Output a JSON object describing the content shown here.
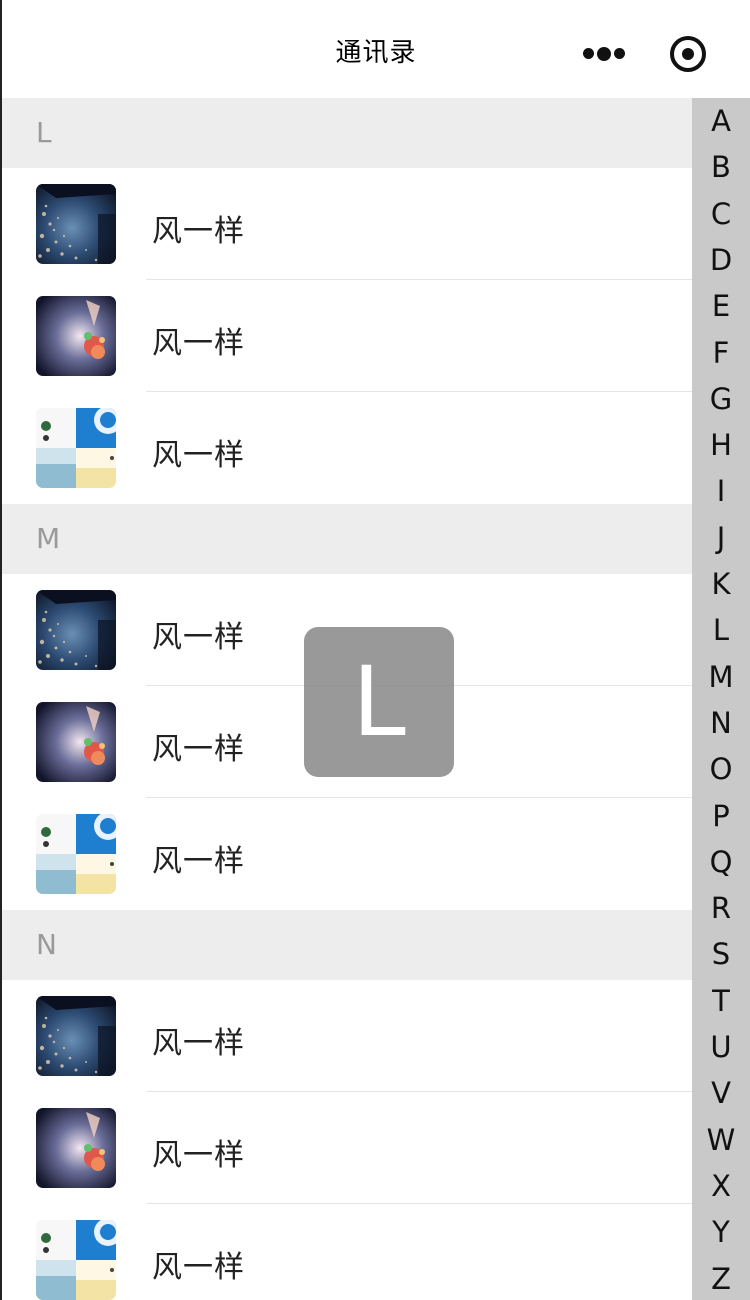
{
  "navbar": {
    "title": "通讯录",
    "menu_icon": "more-dots-icon",
    "close_icon": "close-circle-icon"
  },
  "sections": [
    {
      "letter": "L",
      "contacts": [
        {
          "name": "风一样",
          "avatar": "night-scene"
        },
        {
          "name": "风一样",
          "avatar": "flower"
        },
        {
          "name": "风一样",
          "avatar": "collage"
        }
      ]
    },
    {
      "letter": "M",
      "contacts": [
        {
          "name": "风一样",
          "avatar": "night-scene"
        },
        {
          "name": "风一样",
          "avatar": "flower"
        },
        {
          "name": "风一样",
          "avatar": "collage"
        }
      ]
    },
    {
      "letter": "N",
      "contacts": [
        {
          "name": "风一样",
          "avatar": "night-scene"
        },
        {
          "name": "风一样",
          "avatar": "flower"
        },
        {
          "name": "风一样",
          "avatar": "collage"
        }
      ]
    }
  ],
  "index_letters": [
    "A",
    "B",
    "C",
    "D",
    "E",
    "F",
    "G",
    "H",
    "I",
    "J",
    "K",
    "L",
    "M",
    "N",
    "O",
    "P",
    "Q",
    "R",
    "S",
    "T",
    "U",
    "V",
    "W",
    "X",
    "Y",
    "Z"
  ],
  "overlay_letter": "L",
  "colors": {
    "section_bg": "#ededed",
    "index_bar_bg": "#c9c9c9",
    "overlay_bg": "#808080"
  }
}
